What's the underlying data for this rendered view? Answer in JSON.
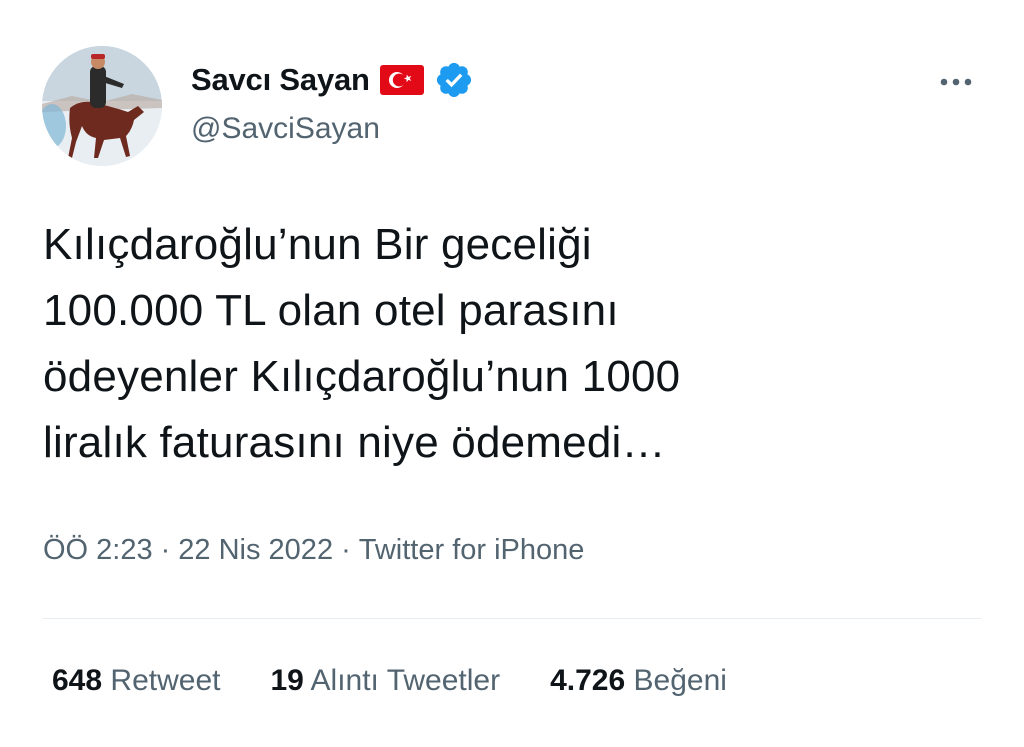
{
  "author": {
    "display_name": "Savcı Sayan",
    "handle": "@SavciSayan",
    "flag_icon": "turkey-flag-icon",
    "verified_icon": "verified-badge-icon",
    "verified_color": "#1d9bf0"
  },
  "tweet": {
    "lines": [
      "Kılıçdaroğlu’nun Bir geceliği",
      "100.000 TL olan otel parasını",
      "ödeyenler Kılıçdaroğlu’nun 1000",
      "liralık faturasını niye ödemedi…"
    ]
  },
  "meta": {
    "time": "ÖÖ 2:23",
    "separator": "·",
    "date": "22 Nis 2022",
    "source": "Twitter for iPhone"
  },
  "stats": {
    "retweets_count": "648",
    "retweets_label": "Retweet",
    "quotes_count": "19",
    "quotes_label": "Alıntı Tweetler",
    "likes_count": "4.726",
    "likes_label": "Beğeni"
  },
  "colors": {
    "text_primary": "#0f1419",
    "text_secondary": "#536471",
    "flag_red": "#e30a17"
  }
}
